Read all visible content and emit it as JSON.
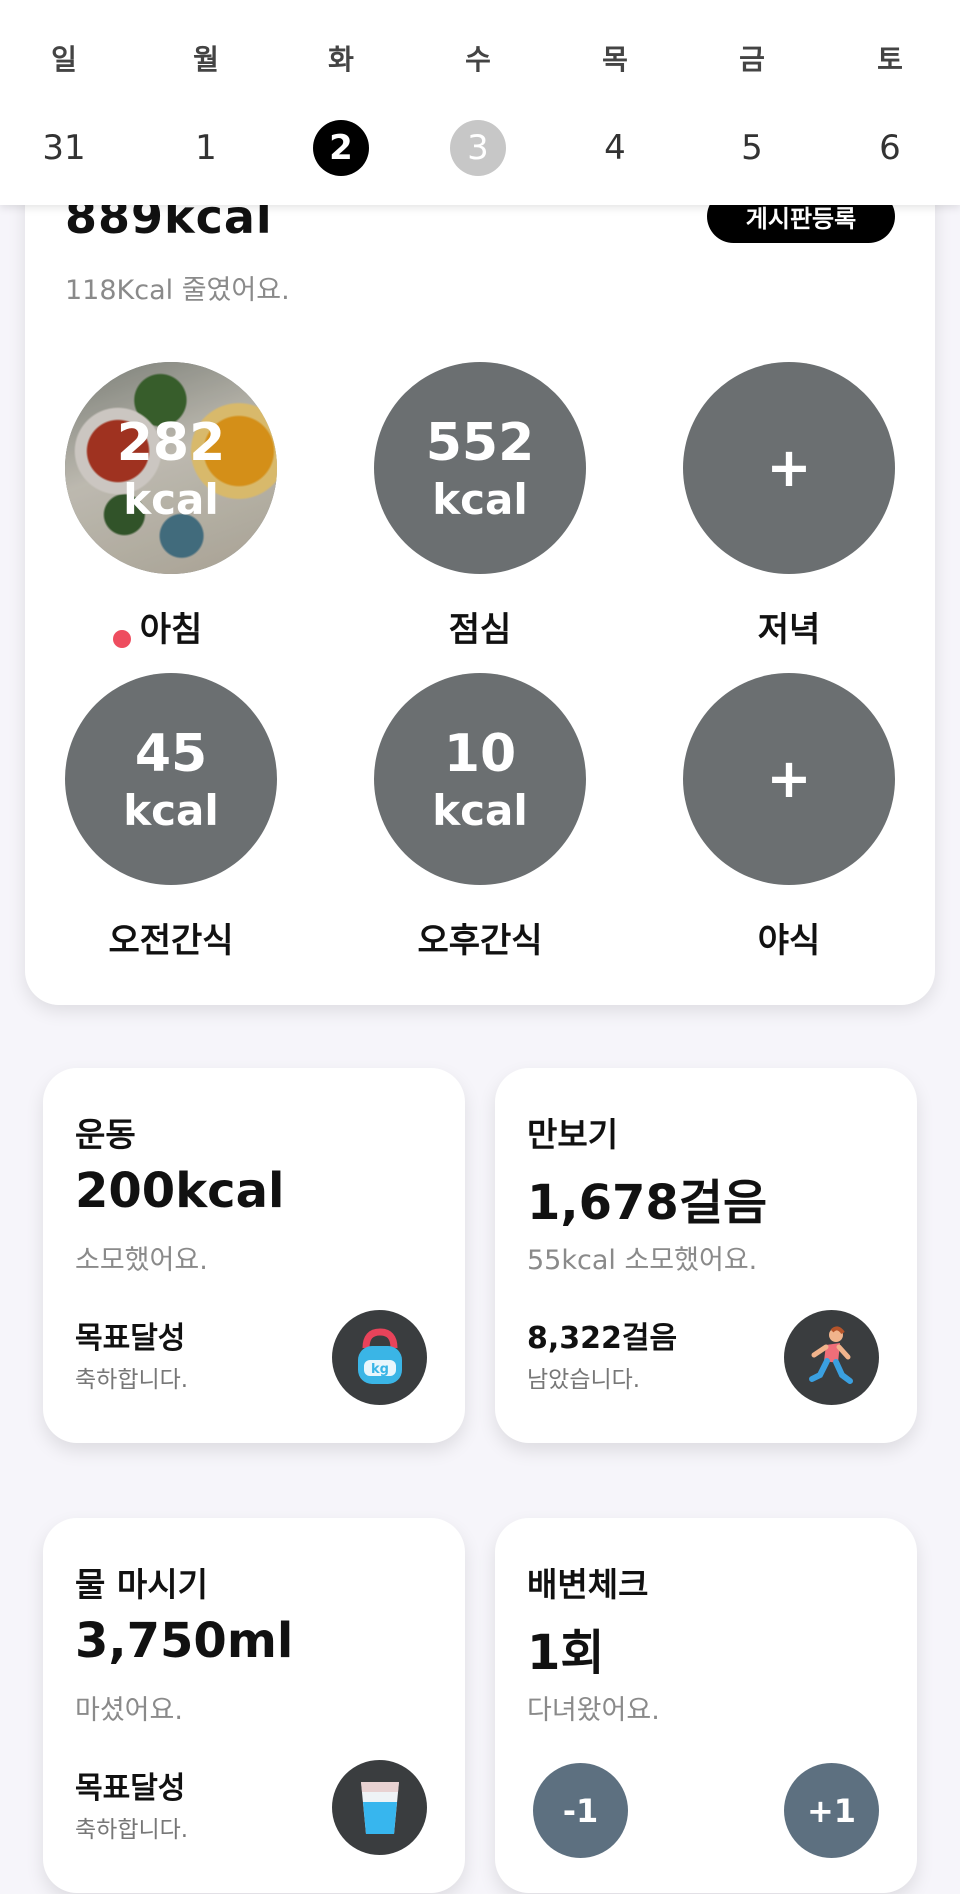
{
  "week": {
    "days": [
      {
        "name": "일",
        "num": "31"
      },
      {
        "name": "월",
        "num": "1"
      },
      {
        "name": "화",
        "num": "2"
      },
      {
        "name": "수",
        "num": "3"
      },
      {
        "name": "목",
        "num": "4"
      },
      {
        "name": "금",
        "num": "5"
      },
      {
        "name": "토",
        "num": "6"
      }
    ],
    "selected_day": "2",
    "today": "3"
  },
  "summary": {
    "total_kcal": "889kcal",
    "reduced_text": "118Kcal 줄였어요.",
    "board_button": "게시판등록"
  },
  "meals": [
    {
      "label": "아침",
      "value": "282",
      "unit": "kcal",
      "has_photo": true,
      "has_dot": true
    },
    {
      "label": "점심",
      "value": "552",
      "unit": "kcal"
    },
    {
      "label": "저녁",
      "value": "+"
    },
    {
      "label": "오전간식",
      "value": "45",
      "unit": "kcal"
    },
    {
      "label": "오후간식",
      "value": "10",
      "unit": "kcal"
    },
    {
      "label": "야식",
      "value": "+"
    }
  ],
  "exercise": {
    "title": "운동",
    "value": "200kcal",
    "sub": "소모했어요.",
    "goal": "목표달성",
    "goal_sub": "축하합니다.",
    "icon": "kettlebell-icon"
  },
  "steps": {
    "title": "만보기",
    "value": "1,678걸음",
    "sub": "55kcal 소모했어요.",
    "goal": "8,322걸음",
    "goal_sub": "남았습니다.",
    "icon": "runner-icon"
  },
  "water": {
    "title": "물 마시기",
    "value": "3,750ml",
    "sub": "마셨어요.",
    "goal": "목표달성",
    "goal_sub": "축하합니다.",
    "icon": "water-glass-icon"
  },
  "bowel": {
    "title": "배변체크",
    "value": "1회",
    "sub": "다녀왔어요.",
    "minus_label": "-1",
    "plus_label": "+1"
  },
  "colors": {
    "circle_gray": "#6b6f71",
    "button_slate": "#5d7080",
    "dot_red": "#ee4d5f"
  }
}
